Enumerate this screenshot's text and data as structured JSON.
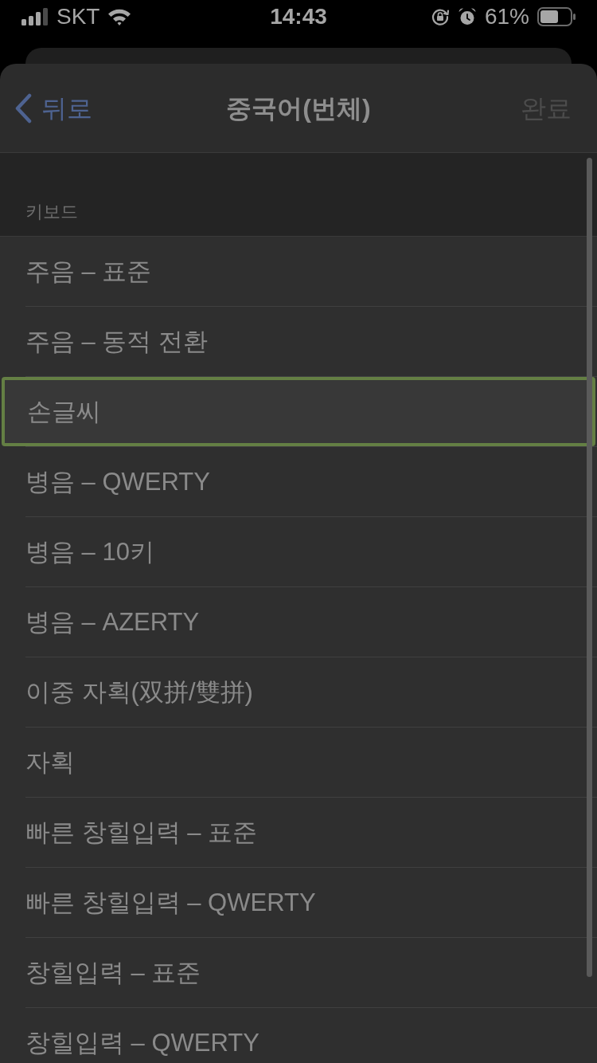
{
  "status_bar": {
    "carrier": "SKT",
    "time": "14:43",
    "battery_text": "61%"
  },
  "nav": {
    "back": "뒤로",
    "title": "중국어(번체)",
    "done": {
      "label": "완료",
      "disabled": true
    }
  },
  "section": {
    "header": "키보드",
    "items": [
      {
        "label": "주음 – 표준",
        "selected": false
      },
      {
        "label": "주음 – 동적 전환",
        "selected": false
      },
      {
        "label": "손글씨",
        "selected": true
      },
      {
        "label": "병음 – QWERTY",
        "selected": false
      },
      {
        "label": "병음 – 10키",
        "selected": false
      },
      {
        "label": "병음 – AZERTY",
        "selected": false
      },
      {
        "label": "이중 자획(双拼/雙拼)",
        "selected": false
      },
      {
        "label": "자획",
        "selected": false
      },
      {
        "label": "빠른 창힐입력 – 표준",
        "selected": false
      },
      {
        "label": "빠른 창힐입력 – QWERTY",
        "selected": false
      },
      {
        "label": "창힐입력 – 표준",
        "selected": false
      },
      {
        "label": "창힐입력 – QWERTY",
        "selected": false
      }
    ]
  }
}
